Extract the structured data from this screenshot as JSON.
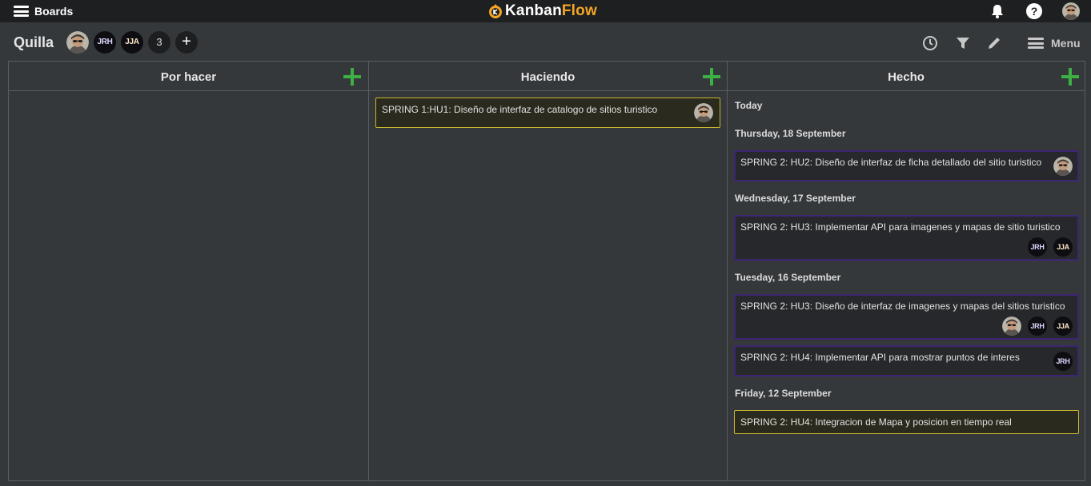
{
  "topbar": {
    "boards_label": "Boards",
    "logo_primary": "Kanban",
    "logo_accent": "Flow",
    "icons": [
      "menu-icon",
      "bell-icon",
      "help-icon",
      "avatar"
    ],
    "help_glyph": "?"
  },
  "board": {
    "title": "Quilla",
    "members": [
      {
        "type": "photo"
      },
      {
        "type": "initials",
        "text": "JRH"
      },
      {
        "type": "initials",
        "text": "JJA"
      }
    ],
    "extra_members_count": "3",
    "add_member_glyph": "+",
    "menu_label": "Menu",
    "tools": [
      "clock-icon",
      "filter-icon",
      "pencil-icon"
    ]
  },
  "columns": [
    {
      "title": "Por hacer",
      "tasks": []
    },
    {
      "title": "Haciendo",
      "tasks": [
        {
          "text": "SPRING 1:HU1: Diseño de interfaz de catalogo de sitios turistico",
          "color": "yellow",
          "assignees": [
            "photo"
          ]
        }
      ]
    },
    {
      "title": "Hecho",
      "groups": [
        {
          "date": "Today",
          "tasks": []
        },
        {
          "date": "Thursday, 18 September",
          "tasks": [
            {
              "text": "SPRING 2: HU2: Diseño de interfaz de ficha detallado del sitio turistico",
              "color": "purple",
              "assignees": [
                "photo"
              ]
            }
          ]
        },
        {
          "date": "Wednesday, 17 September",
          "tasks": [
            {
              "text": "SPRING 2: HU3: Implementar API para imagenes y mapas de sitio turistico",
              "color": "purple",
              "assignees": [
                "JRH",
                "JJA"
              ]
            }
          ]
        },
        {
          "date": "Tuesday, 16 September",
          "tasks": [
            {
              "text": "SPRING 2: HU3: Diseño de interfaz de imagenes y mapas del sitios turistico",
              "color": "purple",
              "assignees": [
                "photo",
                "JRH",
                "JJA"
              ]
            },
            {
              "text": "SPRING 2: HU4: Implementar API para mostrar puntos de interes",
              "color": "purple",
              "assignees": [
                "JRH"
              ]
            }
          ]
        },
        {
          "date": "Friday, 12 September",
          "tasks": [
            {
              "text": "SPRING 2: HU4: Integracion de Mapa y posicion en tiempo real",
              "color": "yellow",
              "assignees": []
            }
          ]
        }
      ]
    }
  ],
  "colors": {
    "background": "#35383b",
    "topbar": "#1e1f21",
    "add_green": "#3cb043",
    "task_yellow_border": "#c8b631",
    "task_purple_border": "#3d2573",
    "logo_accent": "#f5a623"
  }
}
